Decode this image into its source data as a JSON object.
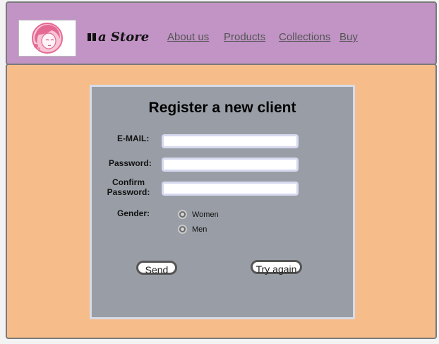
{
  "header": {
    "brand": "a Store",
    "nav": [
      "About us",
      "Products",
      "Collections",
      "Buy"
    ]
  },
  "form": {
    "title": "Register a new client",
    "email_label": "E-MAIL:",
    "email_value": "",
    "password_label": "Password:",
    "password_value": "",
    "confirm_label_line1": "Confirm",
    "confirm_label_line2": "Password:",
    "confirm_value": "",
    "gender_label": "Gender:",
    "gender_options": [
      "Women",
      "Men"
    ],
    "send_label": "Send",
    "reset_label": "Try again"
  },
  "colors": {
    "header_bg": "#c194c5",
    "main_bg": "#f6bd8b",
    "panel_bg": "#999ea6"
  }
}
